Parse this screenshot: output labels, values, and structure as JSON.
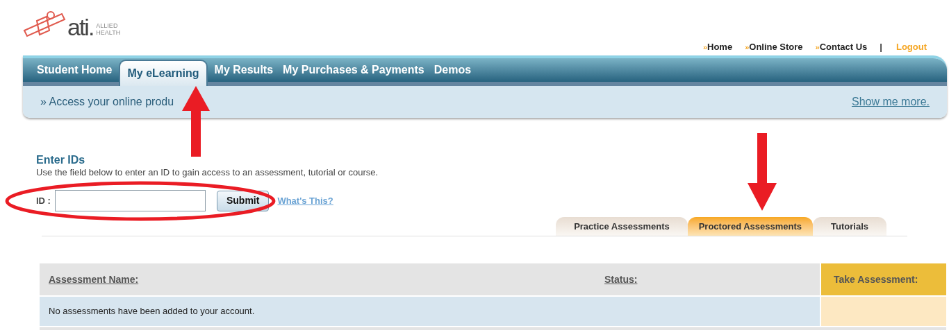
{
  "logo": {
    "wordmark": "ati.",
    "sub_line1": "ALLIED",
    "sub_line2": "HEALTH"
  },
  "top_links": [
    {
      "label": "Home",
      "kind": "link"
    },
    {
      "label": "Online Store",
      "kind": "link"
    },
    {
      "label": "Contact Us",
      "kind": "link"
    },
    {
      "label": "Logout",
      "kind": "logout"
    }
  ],
  "top_links_marker": "»",
  "separator": "|",
  "nav_tabs": [
    {
      "label": "Student Home",
      "selected": false
    },
    {
      "label": "My eLearning",
      "selected": true
    },
    {
      "label": "My Results",
      "selected": false
    },
    {
      "label": "My Purchases & Payments",
      "selected": false
    },
    {
      "label": "Demos",
      "selected": false
    }
  ],
  "banner": {
    "text": "» Access your online produ",
    "link": "Show me more."
  },
  "enter_ids": {
    "title": "Enter IDs",
    "description": "Use the field below to enter an ID to gain access to an assessment, tutorial or course.",
    "field_label": "ID :",
    "submit": "Submit",
    "help_link": "What's This?"
  },
  "assessment_tabs": [
    {
      "label": "Practice Assessments",
      "selected": false
    },
    {
      "label": "Proctored Assessments",
      "selected": true
    },
    {
      "label": "Tutorials",
      "selected": false
    }
  ],
  "table": {
    "columns": [
      "Assessment Name:",
      "Status:",
      "Take Assessment:"
    ],
    "empty_message": "No assessments have been added to your account."
  }
}
